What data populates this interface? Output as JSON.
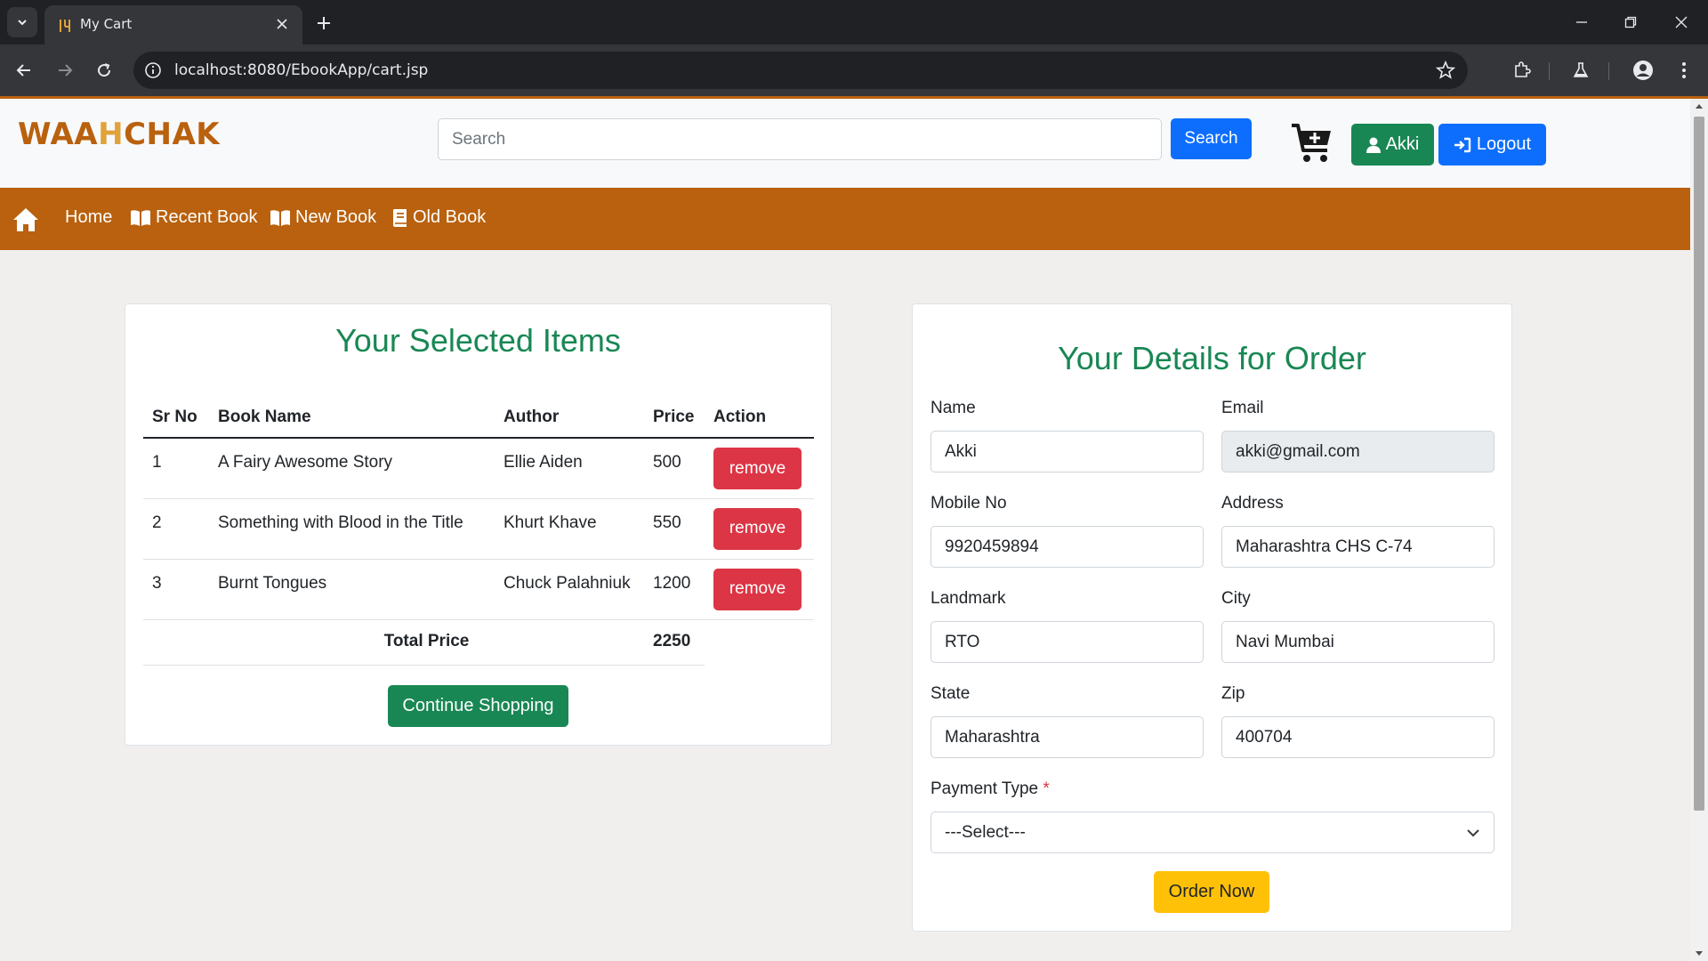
{
  "browser": {
    "tab_title": "My Cart",
    "url": "localhost:8080/EbookApp/cart.jsp"
  },
  "header": {
    "logo_left": "WAA",
    "logo_mid": "H",
    "logo_right": "CHAK",
    "search_placeholder": "Search",
    "search_button": "Search",
    "user_button": "Akki",
    "logout_button": "Logout"
  },
  "nav": {
    "items": [
      {
        "label": "Home",
        "icon": "none"
      },
      {
        "label": "Recent Book",
        "icon": "book-open-icon"
      },
      {
        "label": "New Book",
        "icon": "book-open-icon"
      },
      {
        "label": "Old Book",
        "icon": "book-icon"
      }
    ]
  },
  "cart": {
    "title": "Your Selected Items",
    "columns": [
      "Sr No",
      "Book Name",
      "Author",
      "Price",
      "Action"
    ],
    "rows": [
      {
        "sr": "1",
        "book": "A Fairy Awesome Story",
        "author": "Ellie Aiden",
        "price": "500",
        "action": "remove"
      },
      {
        "sr": "2",
        "book": "Something with Blood in the Title",
        "author": "Khurt Khave",
        "price": "550",
        "action": "remove"
      },
      {
        "sr": "3",
        "book": "Burnt Tongues",
        "author": "Chuck Palahniuk",
        "price": "1200",
        "action": "remove"
      }
    ],
    "total_label": "Total Price",
    "total_value": "2250",
    "continue_button": "Continue Shopping"
  },
  "order": {
    "title": "Your Details for Order",
    "fields": {
      "name": {
        "label": "Name",
        "value": "Akki"
      },
      "email": {
        "label": "Email",
        "value": "akki@gmail.com"
      },
      "mobile": {
        "label": "Mobile No",
        "value": "9920459894"
      },
      "address": {
        "label": "Address",
        "value": "Maharashtra CHS C-74"
      },
      "landmark": {
        "label": "Landmark",
        "value": "RTO"
      },
      "city": {
        "label": "City",
        "value": "Navi Mumbai"
      },
      "state": {
        "label": "State",
        "value": "Maharashtra"
      },
      "zip": {
        "label": "Zip",
        "value": "400704"
      }
    },
    "payment_label": "Payment Type",
    "payment_required_mark": "*",
    "payment_selected": "---Select---",
    "order_button": "Order Now"
  },
  "colors": {
    "brand": "#b9610e",
    "success": "#198754",
    "primary": "#0d6efd",
    "danger": "#dc3545",
    "warning": "#ffc107"
  }
}
